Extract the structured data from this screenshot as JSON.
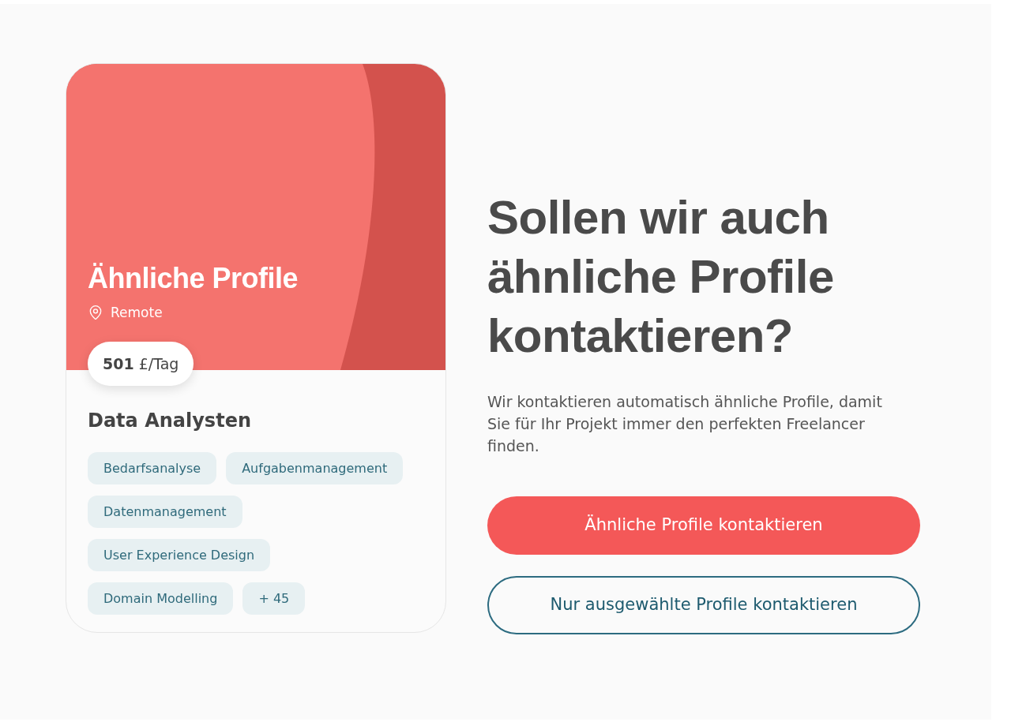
{
  "card": {
    "title": "Ähnliche Profile",
    "location": "Remote",
    "rate": "**501** £/Tag",
    "role": "Data Analysten",
    "skills": [
      "Bedarfsanalyse",
      "Aufgabenmanagement",
      "Datenmanagement",
      "User Experience Design",
      "Domain Modelling"
    ],
    "more_count": "+ 45"
  },
  "heading": "Sollen wir auch ähnliche Profile kontaktieren?",
  "description": "Wir kontaktieren automatisch ähnliche Profile, damit Sie für Ihr Projekt immer den perfekten Freelancer finden.",
  "buttons": [
    {
      "label": "Ähnliche Profile kontaktieren",
      "kind": "primary"
    },
    {
      "label": "Nur ausgewählte Profile kontaktieren",
      "kind": "secondary"
    }
  ]
}
